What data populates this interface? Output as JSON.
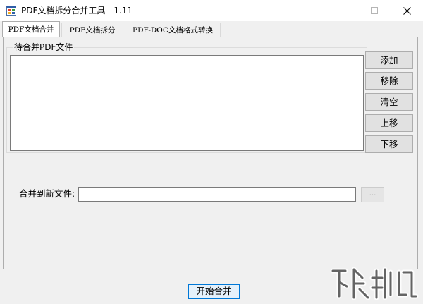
{
  "window": {
    "title": "PDF文档拆分合并工具 - 1.11"
  },
  "tabs": [
    {
      "label": "PDF文档合并",
      "active": true
    },
    {
      "label": "PDF文档拆分",
      "active": false
    },
    {
      "label": "PDF-DOC文档格式转换",
      "active": false
    }
  ],
  "merge": {
    "group_label": "待合并PDF文件",
    "files": [],
    "buttons": {
      "add": "添加",
      "remove": "移除",
      "clear": "清空",
      "move_up": "上移",
      "move_down": "下移"
    },
    "output_label": "合并到新文件:",
    "output_value": "",
    "browse_label": "...",
    "start_label": "开始合并"
  },
  "colors": {
    "accent": "#0078d7",
    "window_bg": "#f0f0f0",
    "button_bg": "#e1e1e1"
  },
  "icons": {
    "app": "app-window-icon",
    "minimize": "minimize-icon",
    "maximize": "maximize-icon",
    "close": "close-icon",
    "watermark": "site-logo"
  }
}
